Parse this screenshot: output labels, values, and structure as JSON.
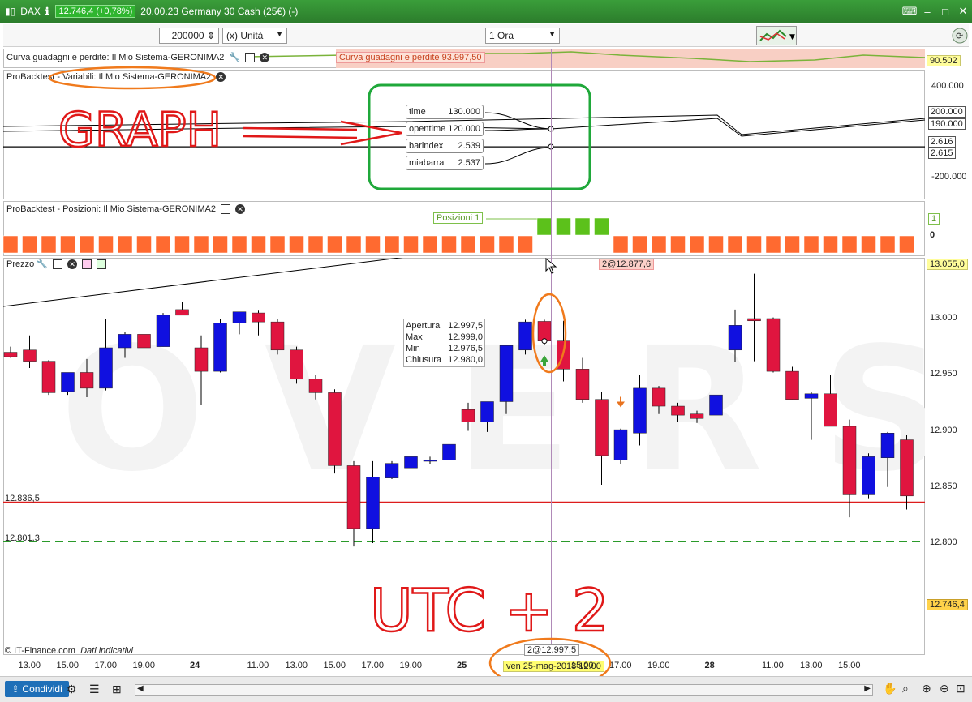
{
  "window": {
    "symbol": "DAX",
    "price": "12.746,4 (+0,78%)",
    "title": "20.00.23 Germany 30 Cash (25€) (-)"
  },
  "toolbar": {
    "quantity": "200000",
    "unit": "(x) Unità",
    "timeframe": "1 Ora"
  },
  "panels": {
    "equity": {
      "label": "Curva guadagni e perdite: Il Mio Sistema-GERONIMA2",
      "tag": "Curva guadagni e perdite  93.997,50",
      "right_value": "90.502"
    },
    "variables": {
      "label": "ProBacktest - Variabili: Il Mio Sistema-GERONIMA2",
      "axis": [
        "400.000",
        "200.000",
        "190.000",
        "2.616",
        "2.615",
        "-200.000"
      ],
      "tooltip": [
        {
          "name": "time",
          "value": "130.000"
        },
        {
          "name": "opentime",
          "value": "120.000"
        },
        {
          "name": "barindex",
          "value": "2.539"
        },
        {
          "name": "miabarra",
          "value": "2.537"
        }
      ]
    },
    "positions": {
      "label": "ProBacktest - Posizioni: Il Mio Sistema-GERONIMA2",
      "tag": "Posizioni   1",
      "right_top": "1",
      "right_zero": "0"
    },
    "price": {
      "label": "Prezzo",
      "top_tag": "2@12.877,6",
      "right_top": "13.055,0",
      "right_bottom": "12.746,4",
      "cursor_tag": "2@12.997,5",
      "date_tag": "ven 25-mag-2018 12.00",
      "hline1": "12.836,5",
      "hline2": "12.801,3",
      "ohlc": [
        {
          "label": "Apertura",
          "value": "12.997,5"
        },
        {
          "label": "Max",
          "value": "12.999,0"
        },
        {
          "label": "Min",
          "value": "12.976,5"
        },
        {
          "label": "Chiusura",
          "value": "12.980,0"
        }
      ],
      "copyright": "© IT-Finance.com",
      "disclaimer": "Dati indicativi"
    }
  },
  "annotations": {
    "graph": "GRAPH",
    "utc": "UTC + 2"
  },
  "xaxis": [
    {
      "t": "13.00",
      "i": 1
    },
    {
      "t": "15.00",
      "i": 3
    },
    {
      "t": "17.00",
      "i": 5
    },
    {
      "t": "19.00",
      "i": 7
    },
    {
      "t": "24",
      "i": 10,
      "b": true
    },
    {
      "t": "11.00",
      "i": 13
    },
    {
      "t": "13.00",
      "i": 15
    },
    {
      "t": "15.00",
      "i": 17
    },
    {
      "t": "17.00",
      "i": 19
    },
    {
      "t": "19.00",
      "i": 21
    },
    {
      "t": "25",
      "i": 24,
      "b": true
    },
    {
      "t": "15.00",
      "i": 30
    },
    {
      "t": "17.00",
      "i": 32
    },
    {
      "t": "19.00",
      "i": 34
    },
    {
      "t": "28",
      "i": 37,
      "b": true
    },
    {
      "t": "11.00",
      "i": 40
    },
    {
      "t": "13.00",
      "i": 42
    },
    {
      "t": "15.00",
      "i": 44
    }
  ],
  "statusbar": {
    "share": "Condividi"
  },
  "chart_data": {
    "type": "candlestick",
    "title": "",
    "ylabel": "",
    "ylim": [
      12796,
      13056
    ],
    "yticks": [
      13000,
      12950,
      12900,
      12850,
      12800
    ],
    "hlines": [
      {
        "value": 12836.5,
        "color": "#dd1c1c",
        "style": "solid"
      },
      {
        "value": 12801.3,
        "color": "#2a9a2a",
        "style": "dashed"
      }
    ],
    "colors": {
      "up": "#1010e0",
      "down": "#e0153f"
    },
    "candles": [
      {
        "o": 12970,
        "h": 12975,
        "l": 12965,
        "c": 12966
      },
      {
        "o": 12972,
        "h": 12985,
        "l": 12956,
        "c": 12962
      },
      {
        "o": 12962,
        "h": 12963,
        "l": 12932,
        "c": 12934
      },
      {
        "o": 12935,
        "h": 12952,
        "l": 12932,
        "c": 12952
      },
      {
        "o": 12952,
        "h": 12964,
        "l": 12930,
        "c": 12938
      },
      {
        "o": 12938,
        "h": 13000,
        "l": 12936,
        "c": 12974
      },
      {
        "o": 12974,
        "h": 12988,
        "l": 12965,
        "c": 12986
      },
      {
        "o": 12986,
        "h": 12986,
        "l": 12964,
        "c": 12974
      },
      {
        "o": 12975,
        "h": 13005,
        "l": 12975,
        "c": 13003
      },
      {
        "o": 13008,
        "h": 13015,
        "l": 13003,
        "c": 13003
      },
      {
        "o": 12974,
        "h": 12985,
        "l": 12923,
        "c": 12953
      },
      {
        "o": 12953,
        "h": 13000,
        "l": 12952,
        "c": 12996
      },
      {
        "o": 12996,
        "h": 13006,
        "l": 12986,
        "c": 13006
      },
      {
        "o": 13005,
        "h": 13007,
        "l": 12985,
        "c": 12997
      },
      {
        "o": 12997,
        "h": 13000,
        "l": 12968,
        "c": 12972
      },
      {
        "o": 12972,
        "h": 12975,
        "l": 12942,
        "c": 12946
      },
      {
        "o": 12946,
        "h": 12950,
        "l": 12928,
        "c": 12934
      },
      {
        "o": 12934,
        "h": 12937,
        "l": 12862,
        "c": 12869
      },
      {
        "o": 12869,
        "h": 12873,
        "l": 12797,
        "c": 12813
      },
      {
        "o": 12813,
        "h": 12873,
        "l": 12800,
        "c": 12859
      },
      {
        "o": 12858,
        "h": 12873,
        "l": 12857,
        "c": 12871
      },
      {
        "o": 12867,
        "h": 12878,
        "l": 12867,
        "c": 12877
      },
      {
        "o": 12874,
        "h": 12877,
        "l": 12870,
        "c": 12874
      },
      {
        "o": 12874,
        "h": 12887,
        "l": 12869,
        "c": 12888
      },
      {
        "o": 12919,
        "h": 12925,
        "l": 12900,
        "c": 12908
      },
      {
        "o": 12908,
        "h": 12925,
        "l": 12899,
        "c": 12926
      },
      {
        "o": 12926,
        "h": 12976,
        "l": 12915,
        "c": 12976
      },
      {
        "o": 12972,
        "h": 12999,
        "l": 12968,
        "c": 12997
      },
      {
        "o": 12997.5,
        "h": 12999,
        "l": 12976.5,
        "c": 12980
      },
      {
        "o": 12980,
        "h": 12998,
        "l": 12944,
        "c": 12955
      },
      {
        "o": 12955,
        "h": 12965,
        "l": 12925,
        "c": 12928
      },
      {
        "o": 12928,
        "h": 12935,
        "l": 12852,
        "c": 12878
      },
      {
        "o": 12874,
        "h": 12902,
        "l": 12870,
        "c": 12901
      },
      {
        "o": 12898,
        "h": 12950,
        "l": 12887,
        "c": 12938
      },
      {
        "o": 12938,
        "h": 12940,
        "l": 12915,
        "c": 12922
      },
      {
        "o": 12922,
        "h": 12925,
        "l": 12908,
        "c": 12914
      },
      {
        "o": 12915,
        "h": 12918,
        "l": 12907,
        "c": 12911
      },
      {
        "o": 12914,
        "h": 12933,
        "l": 12913,
        "c": 12932
      },
      {
        "o": 12972,
        "h": 13008,
        "l": 12961,
        "c": 12994
      },
      {
        "o": 13000,
        "h": 13040,
        "l": 12962,
        "c": 12998
      },
      {
        "o": 13000,
        "h": 13001,
        "l": 12952,
        "c": 12953
      },
      {
        "o": 12953,
        "h": 12957,
        "l": 12928,
        "c": 12928
      },
      {
        "o": 12929,
        "h": 12935,
        "l": 12892,
        "c": 12933
      },
      {
        "o": 12933,
        "h": 12950,
        "l": 12905,
        "c": 12904
      },
      {
        "o": 12904,
        "h": 12910,
        "l": 12823,
        "c": 12843
      },
      {
        "o": 12843,
        "h": 12880,
        "l": 12840,
        "c": 12877
      },
      {
        "o": 12876,
        "h": 12899,
        "l": 12850,
        "c": 12898
      },
      {
        "o": 12892,
        "h": 12896,
        "l": 12830,
        "c": 12842
      }
    ]
  }
}
